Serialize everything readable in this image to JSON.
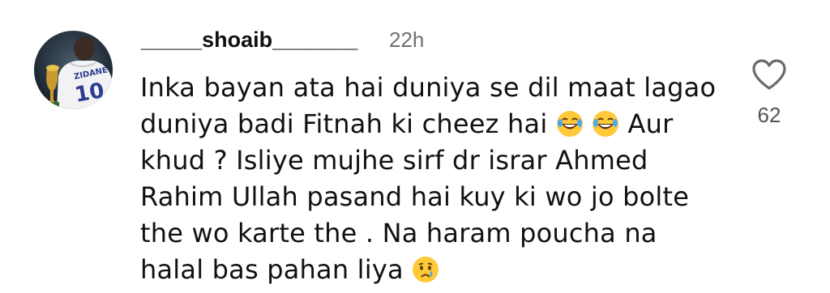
{
  "comment": {
    "username": "_____shoaib_______",
    "timestamp": "22h",
    "text_parts": [
      "Inka bayan ata hai duniya se dil maat lagao duniya badi Fitnah ki cheez hai ",
      " ",
      " Aur khud ? Isliye mujhe sirf dr israr Ahmed Rahim Ullah pasand hai kuy ki wo jo bolte the wo karte the . Na haram poucha na halal bas pahan liya ",
      ""
    ],
    "emojis": [
      "laughing-tears-emoji",
      "laughing-tears-emoji",
      "crying-face-emoji"
    ],
    "likes": "62",
    "avatar_jersey_text": "ZIDANE",
    "avatar_jersey_number": "10"
  },
  "colors": {
    "text": "#111111",
    "timestamp": "#707070",
    "like_count": "#555555",
    "heart_outline": "#6b6b6b"
  },
  "icons": {
    "like": "heart-outline-icon"
  }
}
